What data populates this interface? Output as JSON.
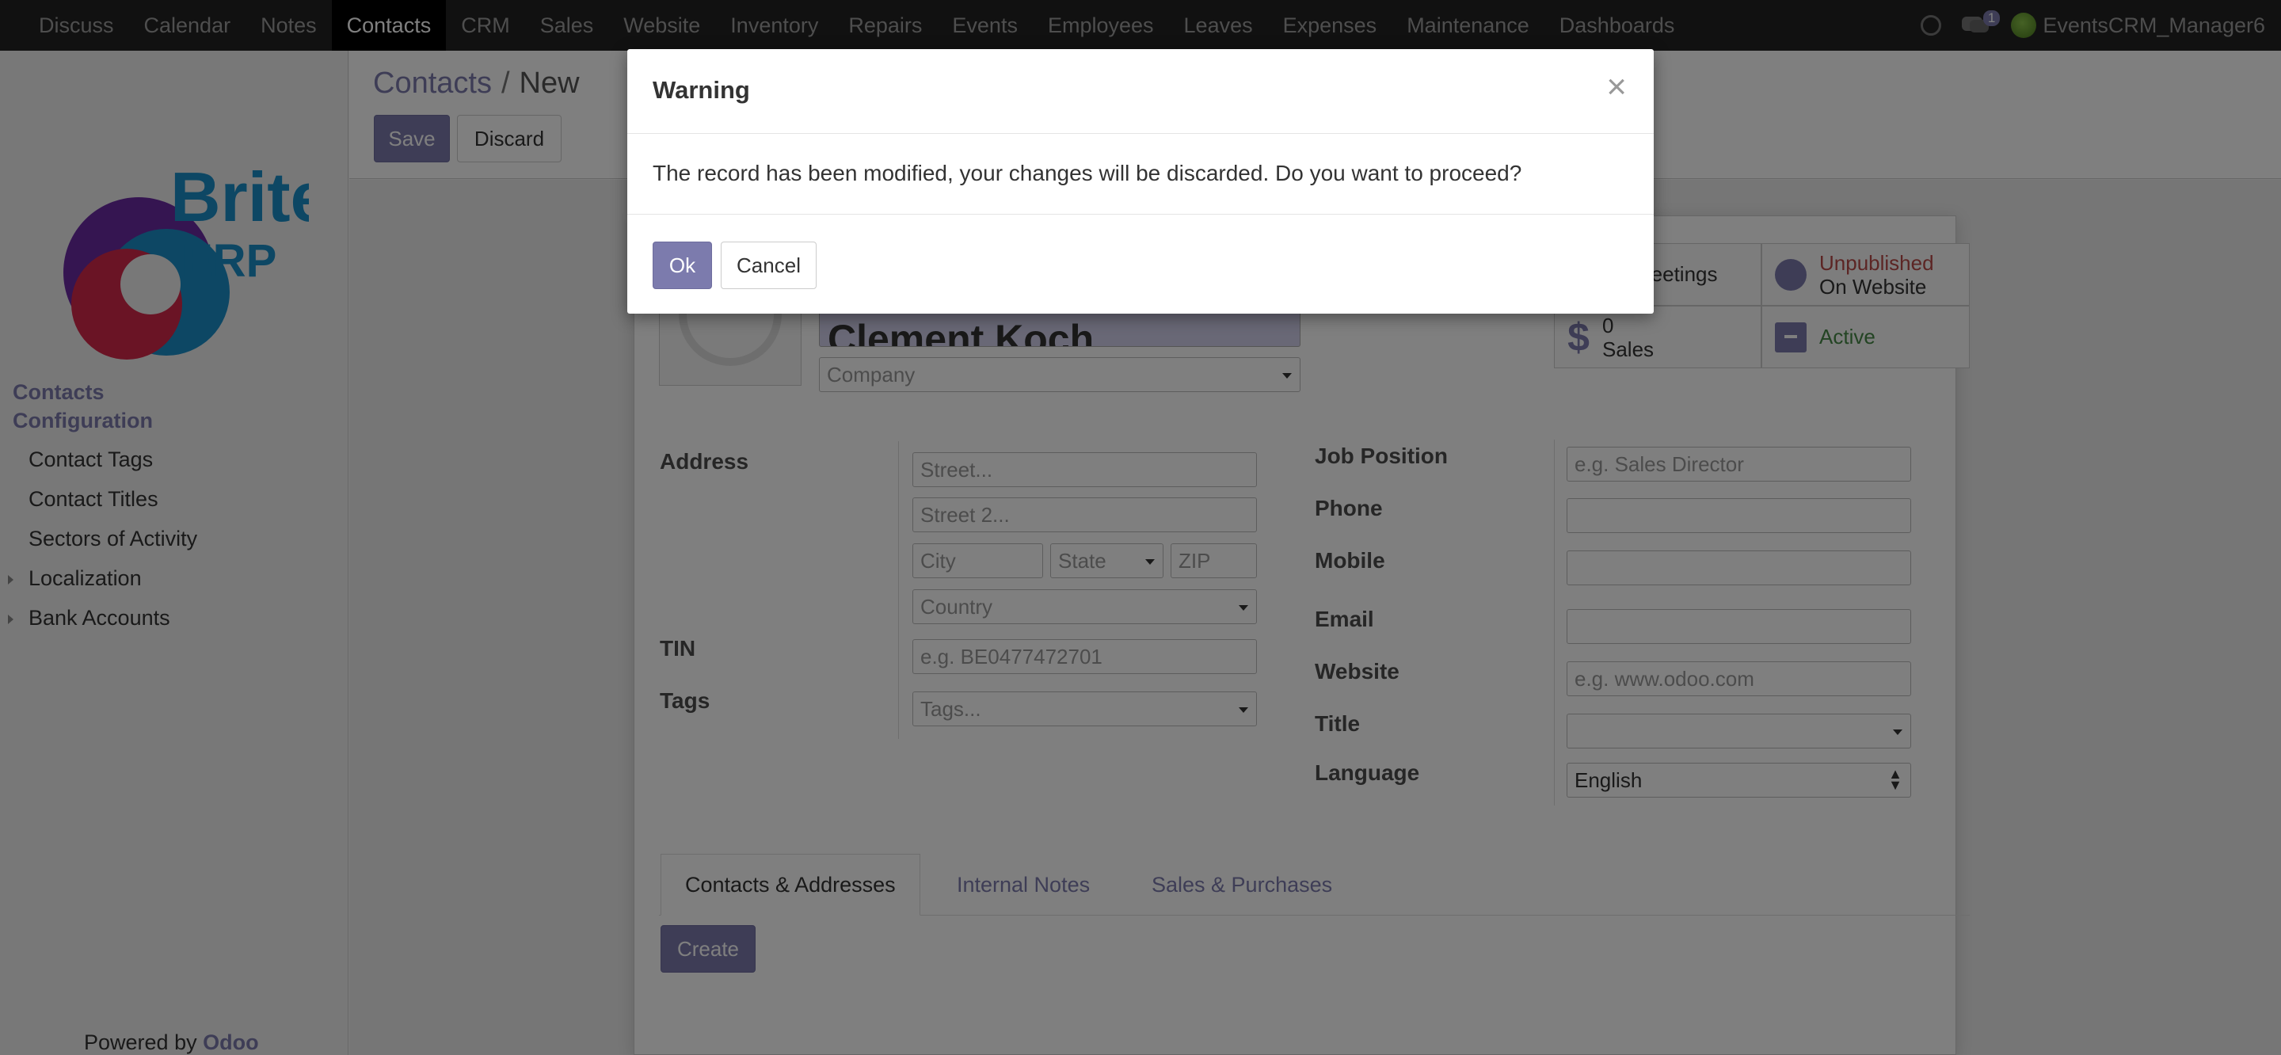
{
  "top_menu": [
    "Discuss",
    "Calendar",
    "Notes",
    "Contacts",
    "CRM",
    "Sales",
    "Website",
    "Inventory",
    "Repairs",
    "Events",
    "Employees",
    "Leaves",
    "Expenses",
    "Maintenance",
    "Dashboards"
  ],
  "active_menu": "Contacts",
  "user": {
    "name": "EventsCRM_Manager6",
    "chat_count": "1"
  },
  "sidebar": {
    "logo": {
      "word1": "Brite",
      "word2": "ERP"
    },
    "sections": [
      "Contacts",
      "Configuration"
    ],
    "items": [
      "Contact Tags",
      "Contact Titles",
      "Sectors of Activity",
      "Localization",
      "Bank Accounts"
    ],
    "powered_prefix": "Powered by",
    "powered_brand": "Odoo"
  },
  "breadcrumb": {
    "parent": "Contacts",
    "separator": "/",
    "current": "New"
  },
  "toolbar": {
    "save_label": "Save",
    "discard_label": "Discard"
  },
  "form": {
    "name": "Clement Koch",
    "company_placeholder": "Company",
    "address_label": "Address",
    "street_placeholder": "Street...",
    "street2_placeholder": "Street 2...",
    "city_placeholder": "City",
    "state_placeholder": "State",
    "zip_placeholder": "ZIP",
    "country_placeholder": "Country",
    "tin_label": "TIN",
    "tin_placeholder": "e.g. BE0477472701",
    "tags_label": "Tags",
    "tags_placeholder": "Tags...",
    "job_label": "Job Position",
    "job_placeholder": "e.g. Sales Director",
    "phone_label": "Phone",
    "mobile_label": "Mobile",
    "email_label": "Email",
    "website_label": "Website",
    "website_placeholder": "e.g. www.odoo.com",
    "title_label": "Title",
    "language_label": "Language",
    "language_value": "English"
  },
  "smart_buttons": {
    "meetings": "Meetings",
    "sales_count": "0",
    "sales_label": "Sales",
    "website_status": "Unpublished",
    "website_sub": "On Website",
    "active_label": "Active"
  },
  "tabs": [
    "Contacts & Addresses",
    "Internal Notes",
    "Sales & Purchases"
  ],
  "create_label": "Create",
  "modal": {
    "title": "Warning",
    "message": "The record has been modified, your changes will be discarded. Do you want to proceed?",
    "ok_label": "Ok",
    "cancel_label": "Cancel"
  },
  "colors": {
    "primary": "#7c7bad",
    "navbar": "#222222",
    "unpublished": "#b94a48",
    "active": "#468847"
  }
}
